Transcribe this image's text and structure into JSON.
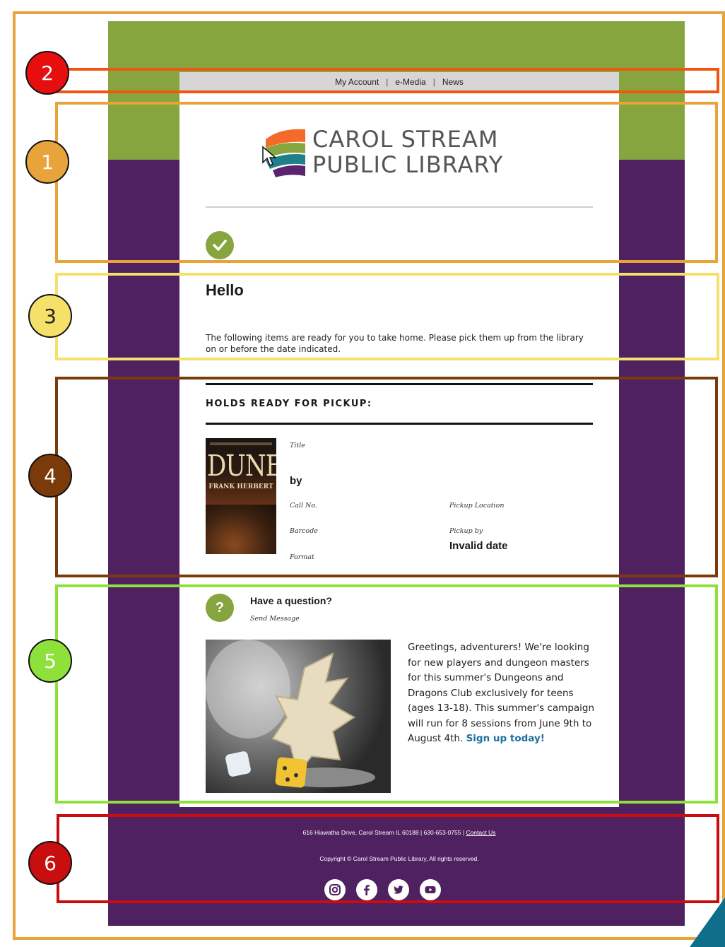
{
  "nav": {
    "my_account": "My Account",
    "e_media": "e-Media",
    "news": "News",
    "separator": "|"
  },
  "library": {
    "name_line1": "CAROL STREAM",
    "name_line2": "PUBLIC LIBRARY"
  },
  "greeting": {
    "title": "Hello",
    "message": "The following items are ready for you to take home. Please pick them up from the library on or before the date indicated."
  },
  "holds": {
    "heading": "HOLDS READY FOR PICKUP:",
    "item": {
      "cover_title": "DUNE",
      "cover_author": "FRANK HERBERT",
      "title_label": "Title",
      "by_label": "by",
      "call_no_label": "Call No.",
      "barcode_label": "Barcode",
      "format_label": "Format",
      "pickup_location_label": "Pickup Location",
      "pickup_by_label": "Pickup by",
      "pickup_by_value": "Invalid date"
    }
  },
  "question": {
    "title": "Have a question?",
    "link": "Send Message",
    "icon_glyph": "?"
  },
  "promo": {
    "text": "Greetings, adventurers! We're looking for new players and dungeon masters for this summer's Dungeons and Dragons Club exclusively for teens (ages 13-18). This summer's campaign will run for 8 sessions from June 9th to August 4th.",
    "cta": "Sign up today!"
  },
  "footer": {
    "address": "616 Hiawatha Drive, Carol Stream IL 60188 | 630-653-0755 |",
    "contact": "Contact Us",
    "copyright": "Copyright © Carol Stream Public Library, All rights reserved.",
    "social": [
      "instagram-icon",
      "facebook-icon",
      "twitter-icon",
      "youtube-icon"
    ]
  },
  "annotations": [
    "1",
    "2",
    "3",
    "4",
    "5",
    "6"
  ],
  "colors": {
    "header_green": "#86a53f",
    "background_purple": "#4f2160",
    "link_blue": "#1e6fa0",
    "box1": "#e8a33a",
    "box2": "#f0560f",
    "box3": "#f5e06a",
    "box4": "#7a3a0a",
    "box5": "#8ee03a",
    "box6": "#c80e0e"
  }
}
